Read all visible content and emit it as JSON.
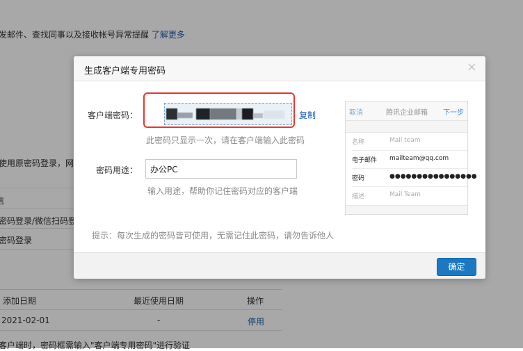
{
  "background": {
    "intro_text": "发邮件、查找同事以及接收帐号异常提醒",
    "intro_link": "了解更多",
    "section_text": "使用原密码登录，网页",
    "left_item_1": "信",
    "left_item_2": "密码登录/微信扫码登",
    "left_item_3": "密码登录",
    "table": {
      "headers": [
        "添加日期",
        "最近使用日期",
        "操作"
      ],
      "rows": [
        {
          "added": "2021-02-01",
          "last_used": "-",
          "action": "停用"
        }
      ]
    },
    "footer_text": "客户端时，密码框需输入\"客户端专用密码\"进行验证"
  },
  "dialog": {
    "title": "生成客户端专用密码",
    "close_glyph": "×",
    "password_label": "客户端密码：",
    "copy_label": "复制",
    "password_hint": "此密码只显示一次，请在客户端输入此密码",
    "purpose_label": "密码用途：",
    "purpose_value": "办公PC",
    "purpose_hint": "输入用途，帮助你记住密码对应的客户端",
    "tip": "提示：每次生成的密码皆可使用，无需记住此密码，请勿告诉他人",
    "ok_label": "确定",
    "highlight_color": "#e9362d",
    "accent_color": "#1b79c4"
  },
  "preview": {
    "cancel": "取消",
    "title": "腾讯企业邮箱",
    "next": "下一步",
    "rows": [
      {
        "key": "名称",
        "value": "Mail team",
        "style": "dim"
      },
      {
        "key": "电子邮件",
        "value": "mailteam@qq.com",
        "style": "dark"
      },
      {
        "key": "密码",
        "value": "●●●●●●●●●●●●●●●●",
        "style": "dark"
      },
      {
        "key": "描述",
        "value": "Mail Team",
        "style": "dim"
      }
    ]
  }
}
